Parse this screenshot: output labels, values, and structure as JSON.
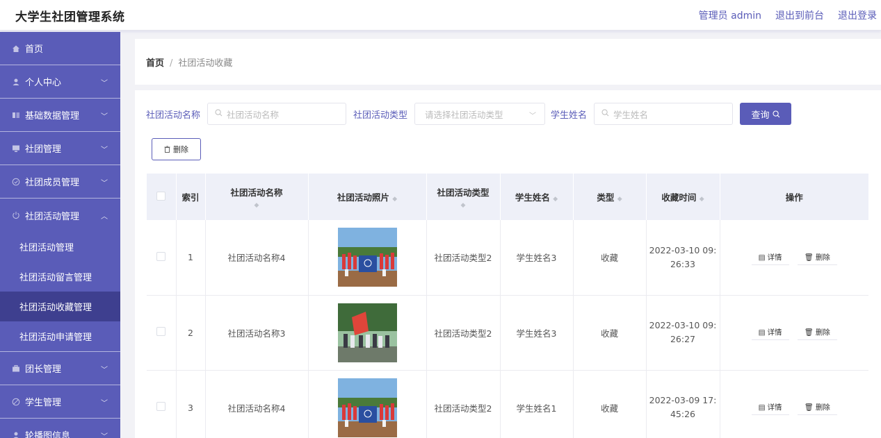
{
  "header": {
    "title": "大学生社团管理系统",
    "links": [
      "管理员 admin",
      "退出到前台",
      "退出登录"
    ]
  },
  "sidebar": {
    "items": [
      {
        "label": "首页",
        "icon": "home-icon"
      },
      {
        "label": "个人中心",
        "icon": "user-icon"
      },
      {
        "label": "基础数据管理",
        "icon": "database-icon"
      },
      {
        "label": "社团管理",
        "icon": "monitor-icon"
      },
      {
        "label": "社团成员管理",
        "icon": "check-circle-icon"
      },
      {
        "label": "社团活动管理",
        "icon": "power-icon"
      },
      {
        "label": "团长管理",
        "icon": "briefcase-icon"
      },
      {
        "label": "学生管理",
        "icon": "ban-icon"
      },
      {
        "label": "轮播图信息",
        "icon": "user-icon"
      }
    ],
    "submenu": [
      {
        "label": "社团活动管理"
      },
      {
        "label": "社团活动留言管理"
      },
      {
        "label": "社团活动收藏管理"
      },
      {
        "label": "社团活动申请管理"
      }
    ]
  },
  "breadcrumb": {
    "home": "首页",
    "separator": "/",
    "current": "社团活动收藏"
  },
  "search": {
    "name_label": "社团活动名称",
    "name_placeholder": "社团活动名称",
    "type_label": "社团活动类型",
    "type_placeholder": "请选择社团活动类型",
    "student_label": "学生姓名",
    "student_placeholder": "学生姓名",
    "query_button": "查询"
  },
  "toolbar": {
    "delete_button": "删除"
  },
  "table": {
    "columns": [
      "索引",
      "社团活动名称",
      "社团活动照片",
      "社团活动类型",
      "学生姓名",
      "类型",
      "收藏时间",
      "操作"
    ],
    "rows": [
      {
        "index": "1",
        "name": "社团活动名称4",
        "type": "社团活动类型2",
        "student": "学生姓名3",
        "kind": "收藏",
        "time_line1": "2022-03-10 09:",
        "time_line2": "26:33"
      },
      {
        "index": "2",
        "name": "社团活动名称3",
        "type": "社团活动类型2",
        "student": "学生姓名3",
        "kind": "收藏",
        "time_line1": "2022-03-10 09:",
        "time_line2": "26:27"
      },
      {
        "index": "3",
        "name": "社团活动名称4",
        "type": "社团活动类型2",
        "student": "学生姓名1",
        "kind": "收藏",
        "time_line1": "2022-03-09 17:",
        "time_line2": "45:26"
      }
    ],
    "detail_label": "详情",
    "delete_label": "删除"
  },
  "colors": {
    "primary": "#5a5cb8",
    "sidebar_active": "#3e3f8f",
    "header_bg": "#eef0f8"
  }
}
